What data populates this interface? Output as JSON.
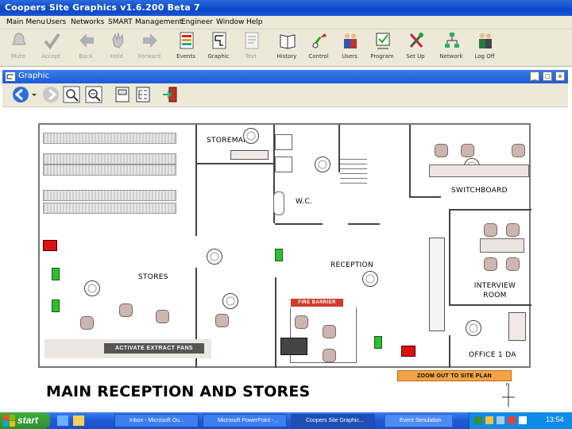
{
  "app_title": "Coopers Site Graphics  v1.6.200  Beta 7",
  "menu": [
    "Main Menu",
    "Users",
    "Networks",
    "SMART",
    "Management",
    "Engineer",
    "Window",
    "Help"
  ],
  "toolbar": [
    {
      "label": "Mute",
      "icon": "bell-icon",
      "enabled": false
    },
    {
      "label": "Accept",
      "icon": "checkmark-icon",
      "enabled": false
    },
    {
      "label": "Back",
      "icon": "back-arrow-icon",
      "enabled": false
    },
    {
      "label": "Hold",
      "icon": "hand-icon",
      "enabled": false
    },
    {
      "label": "Forward",
      "icon": "forward-arrow-icon",
      "enabled": false
    },
    {
      "label": "Events",
      "icon": "events-list-icon",
      "enabled": true
    },
    {
      "label": "Graphic",
      "icon": "graphic-icon",
      "enabled": true
    },
    {
      "label": "Text",
      "icon": "text-icon",
      "enabled": false
    },
    {
      "label": "History",
      "icon": "history-book-icon",
      "enabled": true
    },
    {
      "label": "Control",
      "icon": "control-icon",
      "enabled": true
    },
    {
      "label": "Users",
      "icon": "users-icon",
      "enabled": true
    },
    {
      "label": "Program",
      "icon": "program-icon",
      "enabled": true
    },
    {
      "label": "Set Up",
      "icon": "setup-tools-icon",
      "enabled": true
    },
    {
      "label": "Network",
      "icon": "network-icon",
      "enabled": true
    },
    {
      "label": "Log Off",
      "icon": "log-off-users-icon",
      "enabled": true
    }
  ],
  "graphic_window": {
    "title": "Graphic"
  },
  "rooms": {
    "storeman": "STOREMAN",
    "wc": "W.C.",
    "switchboard": "SWITCHBOARD",
    "reception": "RECEPTION",
    "stores": "STORES",
    "interview": "INTERVIEW\nROOM",
    "office": "OFFICE 1 DA"
  },
  "buttons": {
    "activate_extract": "ACTIVATE EXTRACT FANS",
    "fire_barrier": "FIRE BARRIER",
    "zoom_out": "ZOOM OUT TO SITE PLAN"
  },
  "page_heading": "MAIN RECEPTION AND STORES",
  "taskbar": {
    "start": "start",
    "tasks": [
      "Inbox - Microsoft Ou...",
      "Microsoft PowerPoint -...",
      "Coopers Site Graphic...",
      "Event Simulation"
    ],
    "time": "13:54"
  },
  "colors": {
    "title_blue": "#0a46c8",
    "alarm_red": "#d11111",
    "sensor_green": "#2fbe2f",
    "zoom_orange": "#f3a347"
  }
}
